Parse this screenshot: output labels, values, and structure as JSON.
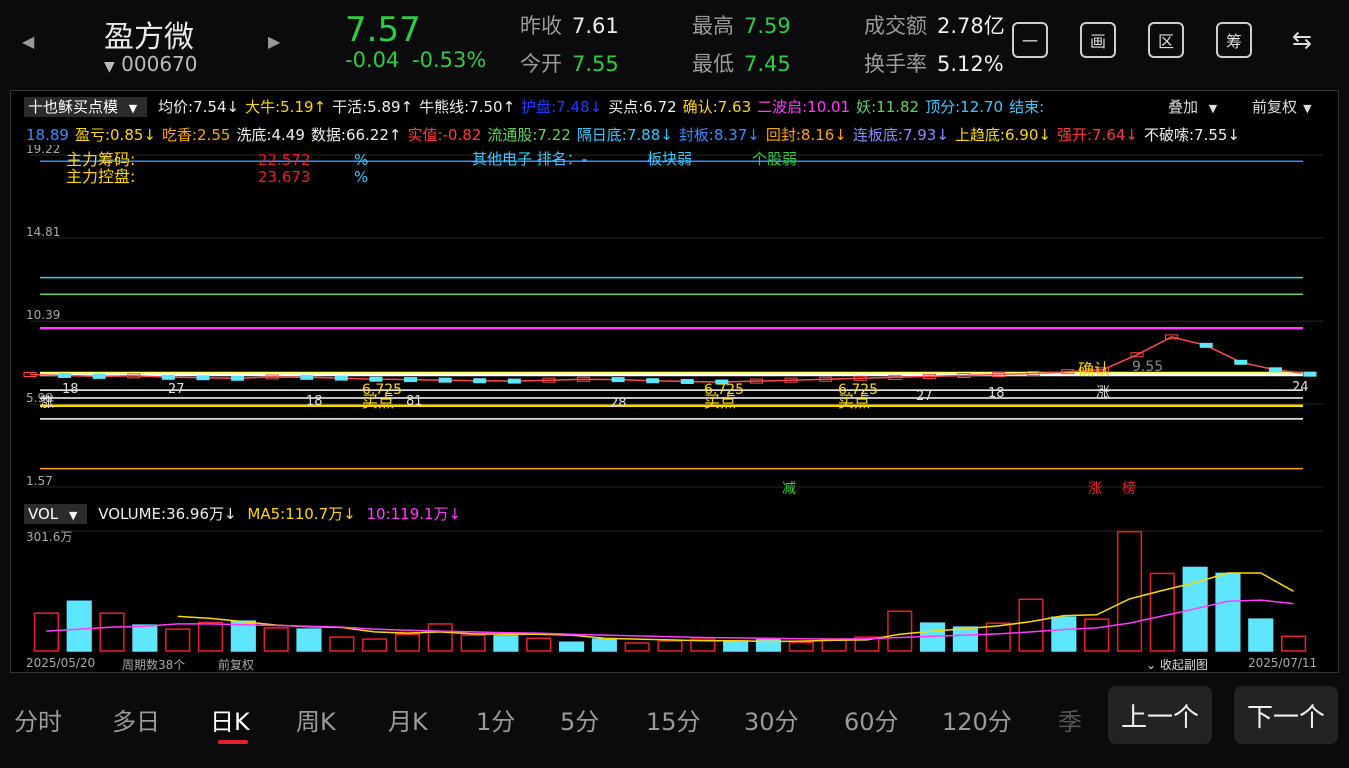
{
  "header": {
    "name": "盈方微",
    "code": "000670",
    "price": "7.57",
    "change": "-0.04",
    "change_pct": "-0.53%",
    "quotes": [
      {
        "label": "昨收",
        "value": "7.61",
        "color": "#eeeeee"
      },
      {
        "label": "今开",
        "value": "7.55",
        "color": "#2ecc40"
      },
      {
        "label": "最高",
        "value": "7.59",
        "color": "#2ecc40"
      },
      {
        "label": "最低",
        "value": "7.45",
        "color": "#2ecc40"
      },
      {
        "label": "成交额",
        "value": "2.78亿",
        "color": "#eeeeee"
      },
      {
        "label": "换手率",
        "value": "5.12%",
        "color": "#eeeeee"
      }
    ],
    "tool_icons": [
      "minus-box-icon",
      "picture-icon",
      "region-icon",
      "chips-icon",
      "switch-device-icon"
    ],
    "tool_glyphs": [
      "一",
      "画",
      "区",
      "筹",
      "⇆"
    ]
  },
  "indicator": {
    "selector": "十也稣买点模",
    "row1": [
      {
        "t": "均价:7.54↓",
        "c": "#eeeeee"
      },
      {
        "t": "大牛:5.19↑",
        "c": "#ffd700"
      },
      {
        "t": "干活:5.89↑",
        "c": "#eeeeee"
      },
      {
        "t": "牛熊线:7.50↑",
        "c": "#eeeeee"
      },
      {
        "t": "护盘:7.48↓",
        "c": "#1e3cff"
      },
      {
        "t": "买点:6.72",
        "c": "#eeeeee"
      },
      {
        "t": "确认:7.63",
        "c": "#ffd700"
      },
      {
        "t": "二波启:10.01",
        "c": "#ff3cff"
      },
      {
        "t": "妖:11.82",
        "c": "#5fd35f"
      },
      {
        "t": "顶分:12.70",
        "c": "#3cc8ff"
      },
      {
        "t": "结束:",
        "c": "#3cc8ff"
      }
    ],
    "overlay": "叠加",
    "adjust": "前复权",
    "row2": [
      {
        "t": "18.89",
        "c": "#3c8cff"
      },
      {
        "t": "盈亏:0.85↓",
        "c": "#ffd700"
      },
      {
        "t": "吃香:2.55",
        "c": "#ffa500"
      },
      {
        "t": "洗底:4.49",
        "c": "#eeeeee"
      },
      {
        "t": "数据:66.22↑",
        "c": "#eeeeee"
      },
      {
        "t": "实值:-0.82",
        "c": "#ff3b3b"
      },
      {
        "t": "流通股:7.22",
        "c": "#5fd35f"
      },
      {
        "t": "隔日底:7.88↓",
        "c": "#3cc8ff"
      },
      {
        "t": "封板:8.37↓",
        "c": "#3c8cff"
      },
      {
        "t": "回封:8.16↓",
        "c": "#ffa500"
      },
      {
        "t": "连板底:7.93↓",
        "c": "#8c8cff"
      },
      {
        "t": "上趋底:6.90↓",
        "c": "#ffd700"
      },
      {
        "t": "强开:7.64↓",
        "c": "#ff3b3b"
      },
      {
        "t": "不破嗦:7.55↓",
        "c": "#eeeeee"
      }
    ],
    "info": {
      "chip_label": "主力筹码:",
      "chip_value": "22.572",
      "ctrl_label": "主力控盘:",
      "ctrl_value": "23.673",
      "pct1": "%",
      "pct2": "%",
      "sector": "其他电子 排名：-",
      "sector_weak": "板块弱",
      "stock_weak": "个股弱"
    },
    "marks": {
      "confirm": "确认",
      "high_label": "9.55",
      "buy": "买点",
      "buy_value": "6.725",
      "reduce": "减",
      "limit_up": "涨",
      "rank": "榜",
      "left_tag": "涨",
      "right_tag": "涨",
      "nums": [
        "18",
        "27",
        "18",
        "81",
        "28",
        "27",
        "18",
        "24"
      ]
    }
  },
  "volume_panel": {
    "selector": "VOL",
    "volume": "VOLUME:36.96万↓",
    "ma5": "MA5:110.7万↓",
    "ma10": "10:119.1万↓",
    "max_label": "301.6万",
    "start_date": "2025/05/20",
    "period_count": "周期数38个",
    "adjust": "前复权",
    "collapse": "收起副图",
    "end_date": "2025/07/11"
  },
  "tabs": [
    "分时",
    "多日",
    "日K",
    "周K",
    "月K",
    "1分",
    "5分",
    "15分",
    "30分",
    "60分",
    "120分",
    "季"
  ],
  "active_tab": "日K",
  "nav": {
    "prev": "上一个",
    "next": "下一个"
  },
  "chart_data": [
    {
      "type": "line",
      "title": "",
      "ylim": [
        1.57,
        19.22
      ],
      "y_ticks": [
        "19.22",
        "14.81",
        "10.39",
        "5.98",
        "1.57"
      ],
      "grid": true,
      "x_count": 38,
      "reference_lines": [
        {
          "name": "结束",
          "value": 18.89,
          "color": "#3c8cff"
        },
        {
          "name": "顶分",
          "value": 12.7,
          "color": "#3cc8ff"
        },
        {
          "name": "妖",
          "value": 11.82,
          "color": "#5fd35f"
        },
        {
          "name": "二波启",
          "value": 10.01,
          "color": "#ff3cff"
        },
        {
          "name": "确认",
          "value": 7.63,
          "color": "#ffff66"
        },
        {
          "name": "均价",
          "value": 7.54,
          "color": "#ffffff"
        },
        {
          "name": "牛熊线",
          "value": 7.5,
          "color": "#ffffff"
        },
        {
          "name": "买点",
          "value": 6.72,
          "color": "#ffffff"
        },
        {
          "name": "上趋底",
          "value": 6.3,
          "color": "#ffffff"
        },
        {
          "name": "干活",
          "value": 5.89,
          "color": "#ffd700"
        },
        {
          "name": "大牛",
          "value": 5.19,
          "color": "#ffffff"
        },
        {
          "name": "吃香",
          "value": 2.55,
          "color": "#ffa500"
        }
      ],
      "close": [
        7.55,
        7.5,
        7.45,
        7.48,
        7.4,
        7.38,
        7.35,
        7.42,
        7.4,
        7.36,
        7.3,
        7.28,
        7.25,
        7.22,
        7.2,
        7.25,
        7.3,
        7.28,
        7.22,
        7.18,
        7.15,
        7.2,
        7.25,
        7.3,
        7.35,
        7.4,
        7.45,
        7.5,
        7.55,
        7.6,
        7.7,
        7.8,
        8.6,
        9.55,
        9.1,
        8.2,
        7.8,
        7.57
      ]
    },
    {
      "type": "bar",
      "title": "",
      "ylim": [
        0,
        301.6
      ],
      "unit": "万",
      "values": [
        95,
        125,
        95,
        65,
        55,
        72,
        75,
        58,
        55,
        35,
        30,
        42,
        68,
        40,
        38,
        32,
        22,
        30,
        20,
        25,
        30,
        25,
        28,
        22,
        30,
        35,
        100,
        70,
        60,
        70,
        130,
        85,
        80,
        300,
        195,
        210,
        195,
        80,
        36.96
      ],
      "up": [
        false,
        true,
        false,
        true,
        false,
        false,
        true,
        false,
        true,
        false,
        false,
        false,
        false,
        false,
        true,
        false,
        true,
        true,
        false,
        false,
        false,
        true,
        true,
        false,
        false,
        false,
        false,
        true,
        true,
        false,
        false,
        true,
        false,
        false,
        false,
        true,
        true,
        true,
        false
      ],
      "ma5": [
        null,
        null,
        null,
        null,
        87,
        82,
        74,
        65,
        61,
        59,
        48,
        45,
        48,
        43,
        42,
        42,
        40,
        32,
        30,
        28,
        26,
        26,
        24,
        25,
        27,
        28,
        42,
        50,
        56,
        63,
        74,
        89,
        91,
        131,
        152,
        172,
        196,
        196,
        150
      ],
      "ma10": [
        50,
        55,
        60,
        62,
        68,
        68,
        66,
        64,
        62,
        60,
        55,
        52,
        50,
        48,
        46,
        45,
        42,
        40,
        38,
        36,
        34,
        33,
        32,
        31,
        30,
        31,
        34,
        37,
        40,
        43,
        48,
        54,
        58,
        70,
        88,
        106,
        125,
        128,
        119.1
      ]
    }
  ]
}
